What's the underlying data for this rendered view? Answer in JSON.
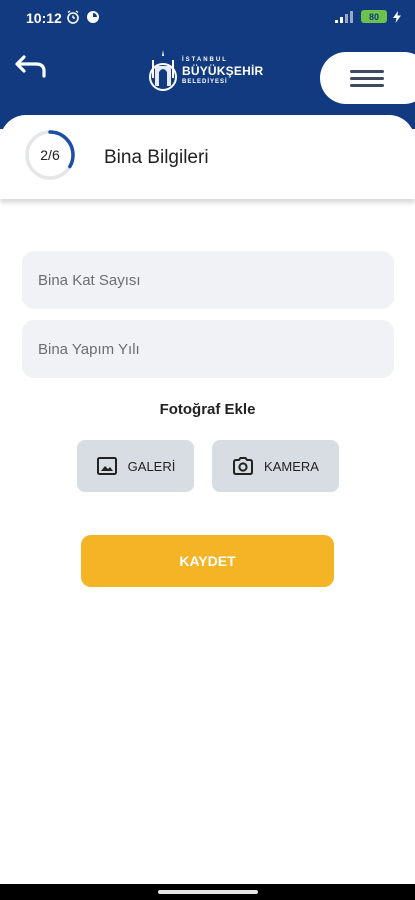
{
  "status_bar": {
    "time": "10:12",
    "battery": "80"
  },
  "header": {
    "logo": {
      "line1": "İSTANBUL",
      "line2": "BÜYÜKŞEHİR",
      "line3": "BELEDİYESİ"
    },
    "back_icon": "back-arrow-icon",
    "menu_icon": "hamburger-menu-icon"
  },
  "step": {
    "progress_text": "2/6",
    "current": 2,
    "total": 6,
    "title": "Bina Bilgileri"
  },
  "form": {
    "floor_count_placeholder": "Bina Kat Sayısı",
    "floor_count_value": "",
    "build_year_placeholder": "Bina Yapım Yılı",
    "build_year_value": "",
    "photo_label": "Fotoğraf Ekle",
    "gallery_label": "GALERİ",
    "camera_label": "KAMERA",
    "save_label": "KAYDET"
  },
  "colors": {
    "header_bg": "#123a80",
    "accent": "#f5b326",
    "progress": "#1e4fa8"
  }
}
